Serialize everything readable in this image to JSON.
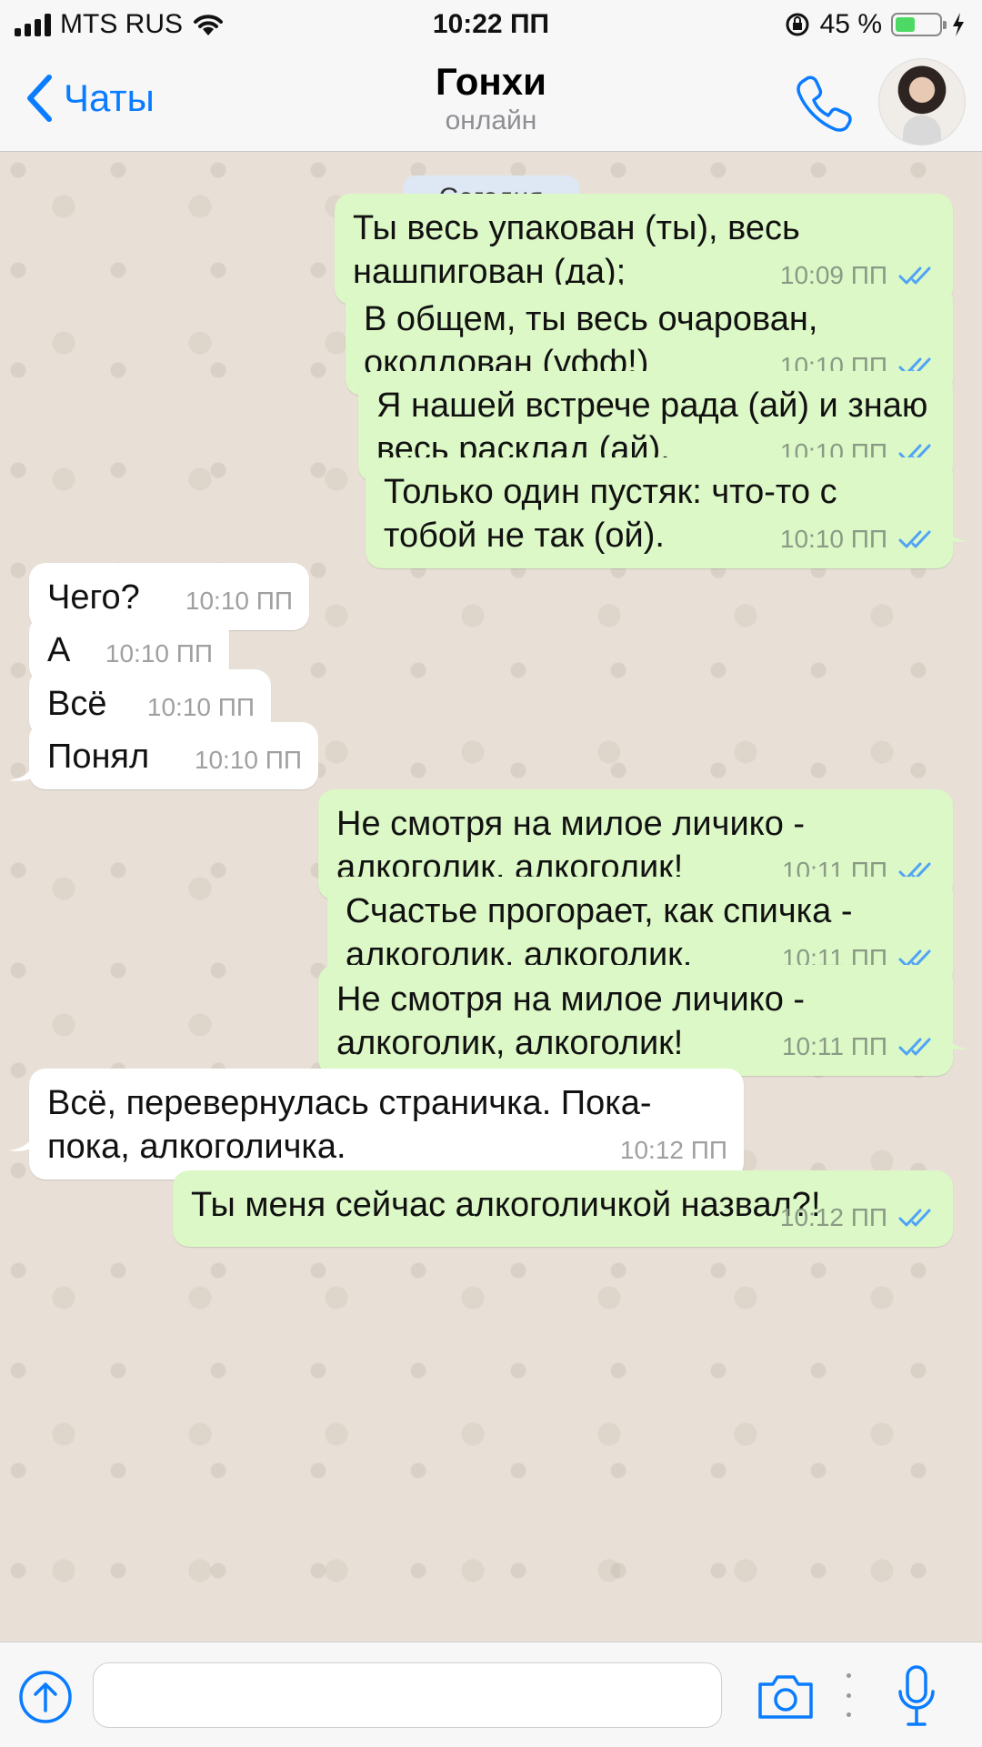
{
  "status": {
    "carrier": "MTS RUS",
    "time": "10:22 ПП",
    "battery": "45 %",
    "battery_level": 0.45
  },
  "nav": {
    "back_label": "Чаты",
    "contact_name": "Гонхи",
    "contact_status": "онлайн"
  },
  "chat": {
    "date_label": "Сегодня",
    "messages": [
      {
        "dir": "out",
        "text": "Ты весь упакован (ты), весь нашпигован (да);",
        "time": "10:09 ПП"
      },
      {
        "dir": "out",
        "text": "В общем, ты весь очарован, околдован (уфф!)",
        "time": "10:10 ПП"
      },
      {
        "dir": "out",
        "text": "Я нашей встрече рада (ай) и знаю весь расклад (ай).",
        "time": "10:10 ПП"
      },
      {
        "dir": "out",
        "text": "Только один пустяк: что-то с тобой не так (ой).",
        "time": "10:10 ПП"
      },
      {
        "dir": "in",
        "text": "Чего?",
        "time": "10:10 ПП"
      },
      {
        "dir": "in",
        "text": "А",
        "time": "10:10 ПП"
      },
      {
        "dir": "in",
        "text": "Всё",
        "time": "10:10 ПП"
      },
      {
        "dir": "in",
        "text": "Понял",
        "time": "10:10 ПП"
      },
      {
        "dir": "out",
        "text": "Не смотря на милое личико - алкоголик, алкоголик!",
        "time": "10:11 ПП"
      },
      {
        "dir": "out",
        "text": "Счастье прогорает, как спичка - алкоголик, алкоголик.",
        "time": "10:11 ПП"
      },
      {
        "dir": "out",
        "text": "Не смотря на милое личико - алкоголик, алкоголик!",
        "time": "10:11 ПП"
      },
      {
        "dir": "in",
        "text": "Всё, перевернулась страничка. Пока-пока, алкоголичка.",
        "time": "10:12 ПП"
      },
      {
        "dir": "out",
        "text": "Ты меня сейчас алкоголичкой назвал?!",
        "time": "10:12 ПП"
      }
    ]
  },
  "input": {
    "placeholder": ""
  },
  "icons": {
    "back": "chevron-left-icon",
    "call": "phone-icon",
    "upload": "arrow-up-circle-icon",
    "camera": "camera-icon",
    "mic": "microphone-icon",
    "read": "double-check-icon"
  },
  "colors": {
    "accent": "#0a7cff",
    "outgoing_bubble": "#dcf8c6",
    "incoming_bubble": "#ffffff",
    "read_tick": "#4fa3f7",
    "chat_background": "#e8e0d7"
  }
}
